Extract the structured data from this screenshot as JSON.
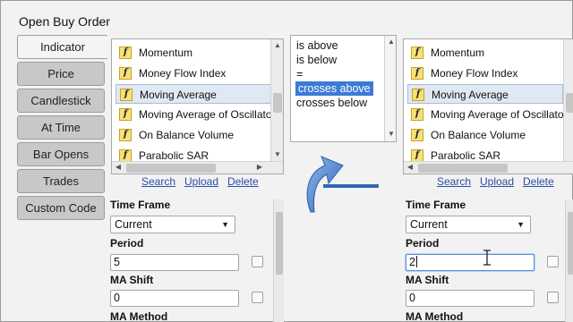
{
  "window": {
    "title": "Open Buy Order"
  },
  "tabs": [
    {
      "label": "Indicator",
      "active": true
    },
    {
      "label": "Price",
      "active": false
    },
    {
      "label": "Candlestick",
      "active": false
    },
    {
      "label": "At Time",
      "active": false
    },
    {
      "label": "Bar Opens",
      "active": false
    },
    {
      "label": "Trades",
      "active": false
    },
    {
      "label": "Custom Code",
      "active": false
    }
  ],
  "indicator_list": {
    "items": [
      "Momentum",
      "Money Flow Index",
      "Moving Average",
      "Moving Average of Oscillator",
      "On Balance Volume",
      "Parabolic SAR"
    ],
    "selected": "Moving Average"
  },
  "list_links": {
    "search": "Search",
    "upload": "Upload",
    "delete": "Delete"
  },
  "operators": {
    "items": [
      "is above",
      "is below",
      "=",
      "crosses above",
      "crosses below"
    ],
    "selected": "crosses above"
  },
  "left_params": {
    "time_frame_label": "Time Frame",
    "time_frame_value": "Current",
    "period_label": "Period",
    "period_value": "5",
    "ma_shift_label": "MA Shift",
    "ma_shift_value": "0",
    "ma_method_label": "MA Method"
  },
  "right_params": {
    "time_frame_label": "Time Frame",
    "time_frame_value": "Current",
    "period_label": "Period",
    "period_value": "2",
    "ma_shift_label": "MA Shift",
    "ma_shift_value": "0",
    "ma_method_label": "MA Method"
  },
  "icons": {
    "function": "f",
    "arrow": "curved-arrow-icon"
  },
  "colors": {
    "selection": "#3d7ad6",
    "link": "#2a4fa3",
    "arrow": "#3c77c9",
    "tab_inactive": "#c8c8c8"
  }
}
